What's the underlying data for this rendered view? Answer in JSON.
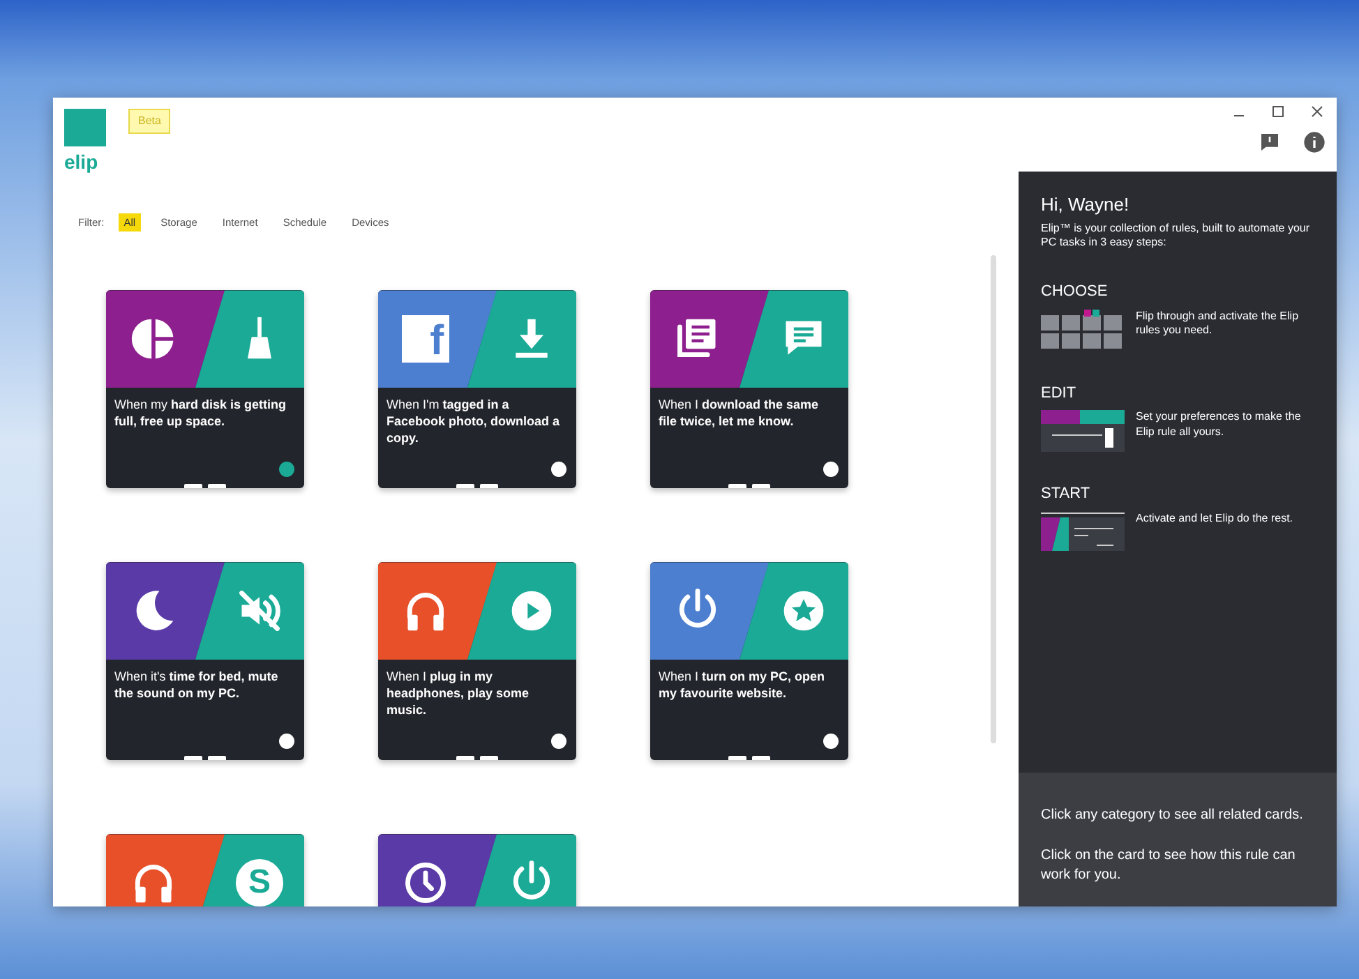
{
  "app": {
    "logo_text": "elip",
    "badge": "Beta"
  },
  "filter": {
    "label": "Filter:",
    "items": [
      {
        "label": "All",
        "selected": true
      },
      {
        "label": "Storage",
        "selected": false
      },
      {
        "label": "Internet",
        "selected": false
      },
      {
        "label": "Schedule",
        "selected": false
      },
      {
        "label": "Devices",
        "selected": false
      }
    ]
  },
  "cards": [
    {
      "left": {
        "color": "#8e1f8e",
        "kind": "pie"
      },
      "right": {
        "color": "#1aaa96",
        "kind": "broom"
      },
      "text": "When my **hard disk is getting full, free up space.**",
      "on": true
    },
    {
      "left": {
        "color": "#4d7fd0",
        "kind": "letterbox",
        "glyph": "f"
      },
      "right": {
        "color": "#1aaa96",
        "kind": "download"
      },
      "text": "When I'm **tagged in a Facebook photo, download a copy.**",
      "on": false
    },
    {
      "left": {
        "color": "#8e1f8e",
        "kind": "documents"
      },
      "right": {
        "color": "#1aaa96",
        "kind": "chat"
      },
      "text": "When I **download the same file twice, let me know.**",
      "on": false
    },
    {
      "left": {
        "color": "#5a3aa6",
        "kind": "moon"
      },
      "right": {
        "color": "#1aaa96",
        "kind": "mute"
      },
      "text": "When it's **time for bed, mute the sound on my PC.**",
      "on": false
    },
    {
      "left": {
        "color": "#e8502a",
        "kind": "headphones"
      },
      "right": {
        "color": "#1aaa96",
        "kind": "play"
      },
      "text": "When I **plug in my headphones, play some music.**",
      "on": false
    },
    {
      "left": {
        "color": "#4d7fd0",
        "kind": "power"
      },
      "right": {
        "color": "#1aaa96",
        "kind": "star"
      },
      "text": "When I **turn on my PC, open my favourite website.**",
      "on": false
    },
    {
      "left": {
        "color": "#e8502a",
        "kind": "headphones"
      },
      "right": {
        "color": "#1aaa96",
        "kind": "lettercircle",
        "glyph": "S"
      }
    },
    {
      "left": {
        "color": "#5a3aa6",
        "kind": "clock"
      },
      "right": {
        "color": "#1aaa96",
        "kind": "power"
      }
    }
  ],
  "side_panel": {
    "greeting": "Hi, Wayne!",
    "intro": "Elip™ is your collection of rules, built to automate your PC tasks in 3 easy steps:",
    "steps": [
      {
        "kind": "choose",
        "title": "CHOOSE",
        "text": "Flip through and activate the Elip rules you need."
      },
      {
        "kind": "edit",
        "title": "EDIT",
        "text": "Set your preferences to make the Elip rule all yours."
      },
      {
        "kind": "start",
        "title": "START",
        "text": "Activate and let Elip do the rest."
      }
    ],
    "tips": [
      "Click any category to see all related cards.",
      "Click on the card to see how this rule can work for you."
    ]
  }
}
